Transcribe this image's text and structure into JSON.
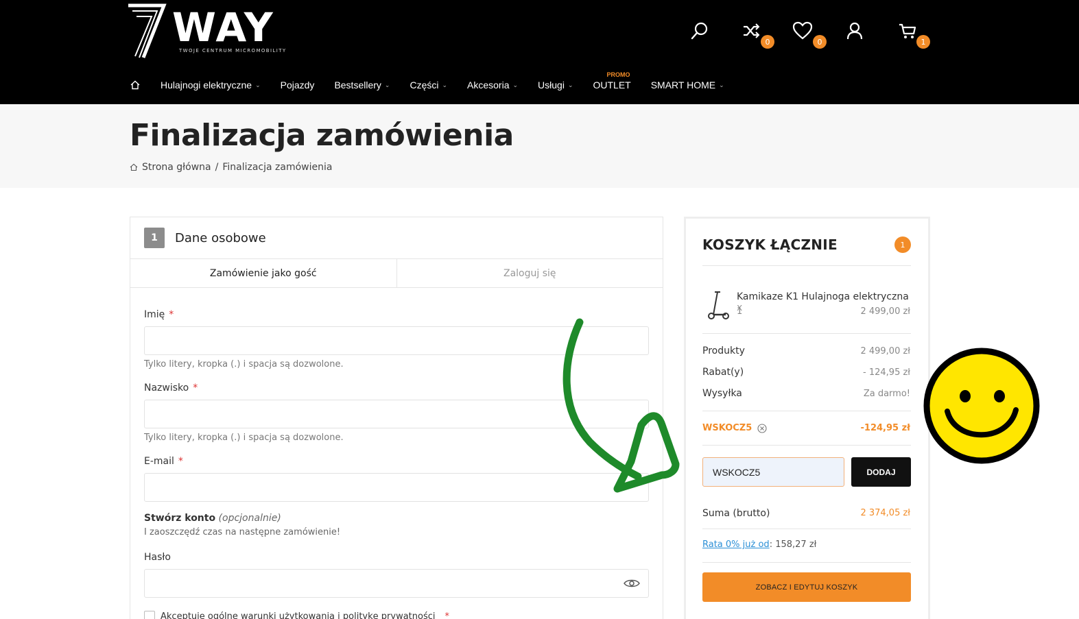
{
  "brand": {
    "logo_text": "WAY",
    "tagline": "TWOJE CENTRUM MICROMOBILITY"
  },
  "header": {
    "compare_count": "0",
    "wishlist_count": "0",
    "cart_count": "1"
  },
  "nav": {
    "items": [
      {
        "label": "Hulajnogi elektryczne",
        "dropdown": true
      },
      {
        "label": "Pojazdy",
        "dropdown": false
      },
      {
        "label": "Bestsellery",
        "dropdown": true
      },
      {
        "label": "Części",
        "dropdown": true
      },
      {
        "label": "Akcesoria",
        "dropdown": true
      },
      {
        "label": "Usługi",
        "dropdown": true
      },
      {
        "label": "OUTLET",
        "dropdown": false,
        "badge": "PROMO"
      },
      {
        "label": "SMART HOME",
        "dropdown": true
      }
    ]
  },
  "page": {
    "title": "Finalizacja zamówienia",
    "breadcrumb": [
      "Strona główna",
      "Finalizacja zamówienia"
    ],
    "breadcrumb_sep": "/"
  },
  "checkout": {
    "step_number": "1",
    "step_title": "Dane osobowe",
    "tabs": [
      "Zamówienie jako gość",
      "Zaloguj się"
    ],
    "first_name_label": "Imię",
    "last_name_label": "Nazwisko",
    "email_label": "E-mail",
    "required_mark": "*",
    "name_hint": "Tylko litery, kropka (.) i spacja są dozwolone.",
    "create_account_label": "Stwórz konto",
    "optional_label": "(opcjonalnie)",
    "create_account_hint": "I zaoszczędź czas na następne zamówienie!",
    "password_label": "Hasło",
    "terms_label": "Akceptuję ogólne warunki użytkowania i politykę prywatności"
  },
  "cart": {
    "title": "KOSZYK ŁĄCZNIE",
    "count": "1",
    "product_name": "Kamikaze K1 Hulajnoga elektryczna",
    "product_x": "x",
    "product_qty": "1",
    "product_price": "2 499,00 zł",
    "rows": [
      {
        "label": "Produkty",
        "value": "2 499,00 zł"
      },
      {
        "label": "Rabat(y)",
        "value": "- 124,95 zł"
      },
      {
        "label": "Wysyłka",
        "value": "Za darmo!"
      }
    ],
    "coupon_code": "WSKOCZ5",
    "coupon_value": "-124,95 zł",
    "coupon_input_value": "WSKOCZ5",
    "coupon_button": "DODAJ",
    "total_label": "Suma (brutto)",
    "total_value": "2 374,05 zł",
    "installment_link": "Rata 0% już od",
    "installment_value": ": 158,27 zł",
    "cta_label": "ZOBACZ I EDYTUJ KOSZYK"
  },
  "colors": {
    "accent": "#f28c28",
    "header_bg": "#000000",
    "arrow": "#1e8a2a",
    "smiley": "#ffe600"
  }
}
